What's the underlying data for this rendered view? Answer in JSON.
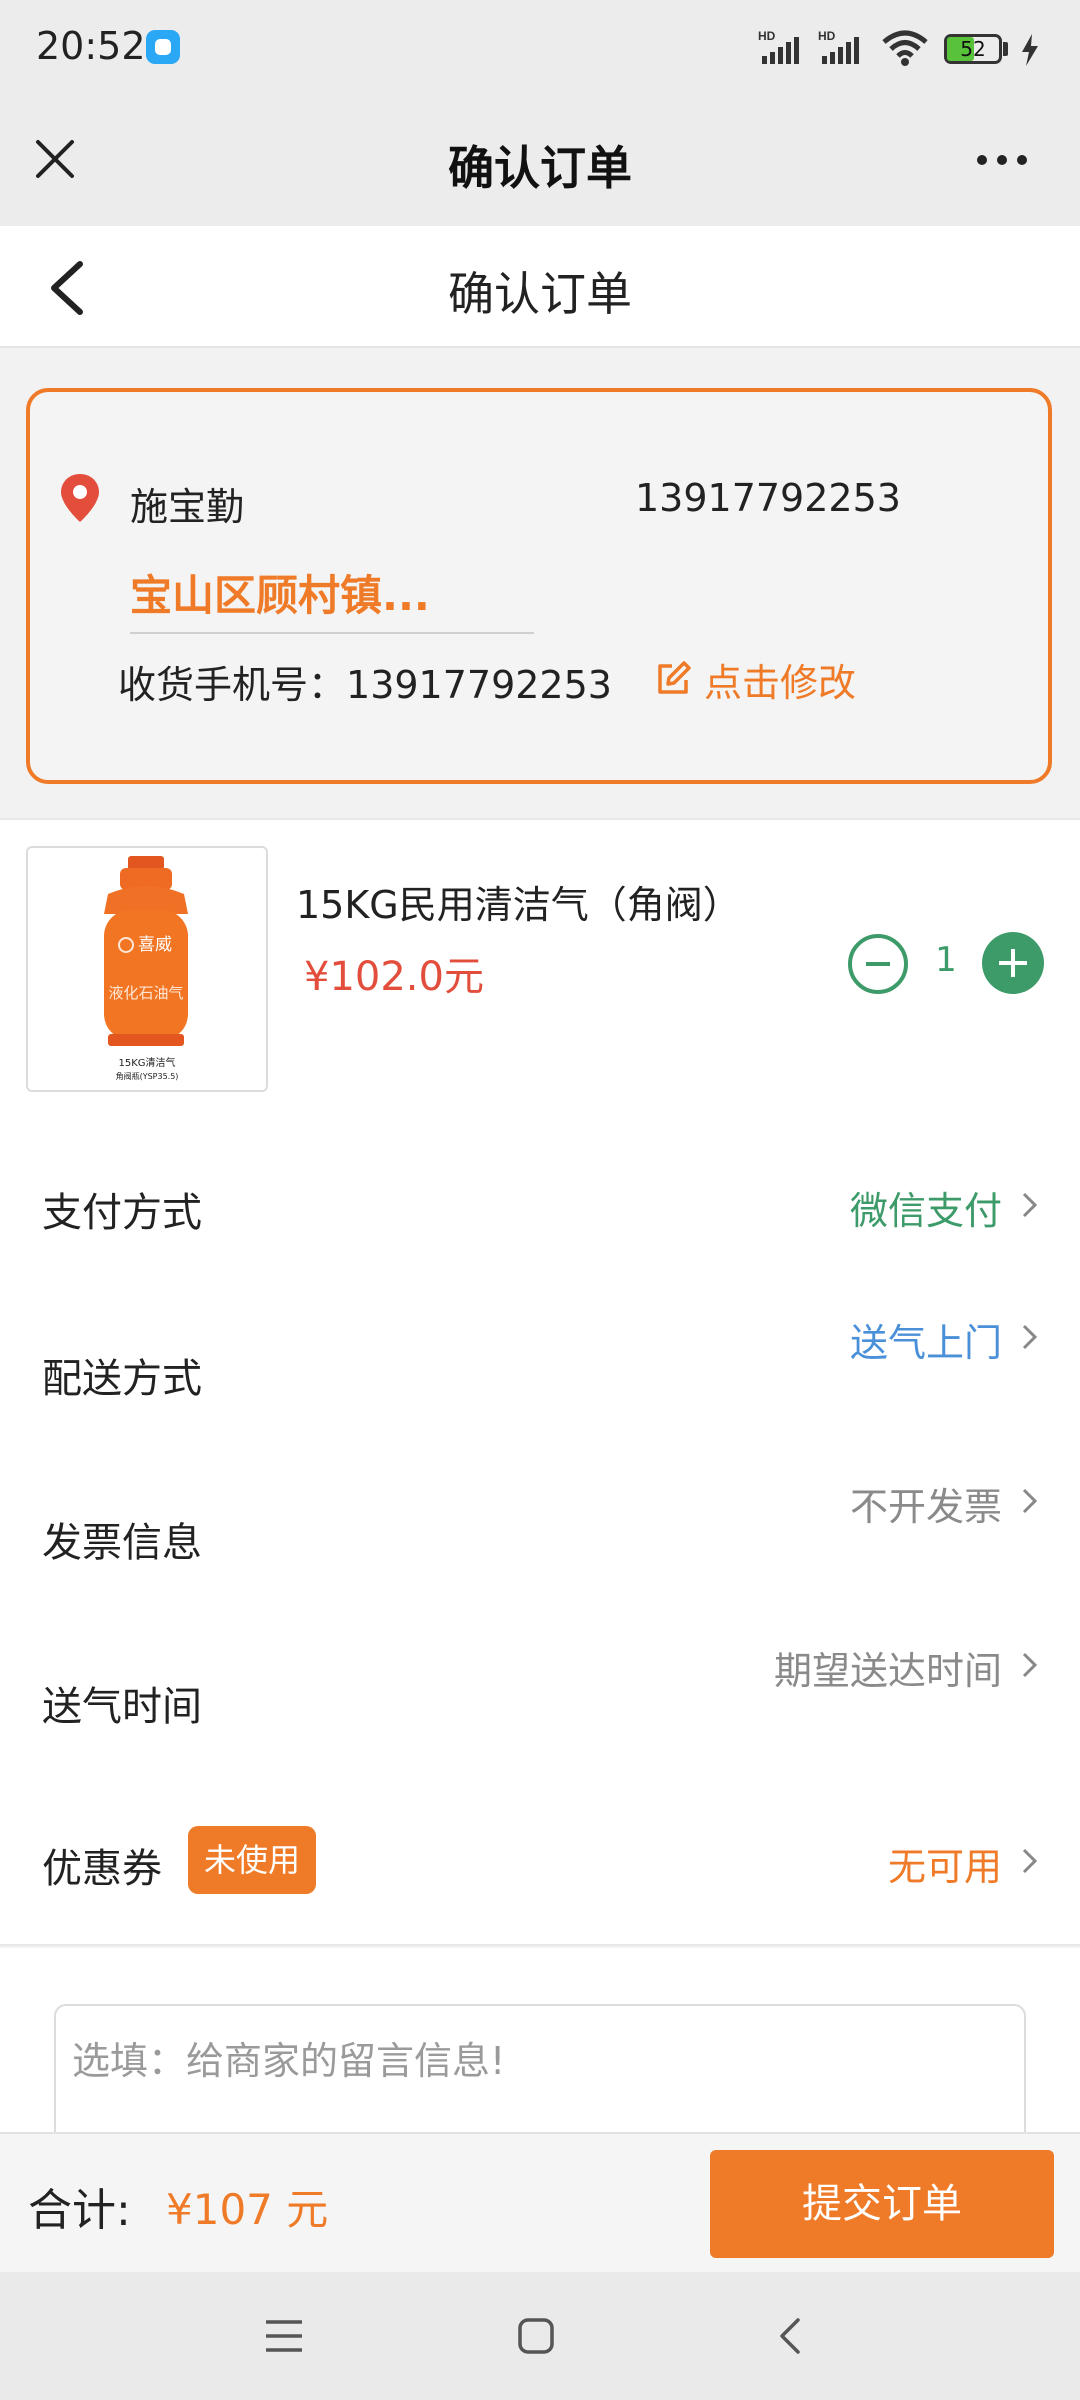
{
  "status_bar": {
    "time": "20:52",
    "signal1": "HD",
    "signal2": "HD",
    "battery": "52",
    "battery_level_pct": 52
  },
  "topbar": {
    "title": "确认订单",
    "close_icon": "close-icon",
    "more_icon": "more-icon"
  },
  "header": {
    "title": "确认订单",
    "back_icon": "back-icon"
  },
  "address": {
    "name": "施宝勤",
    "phone": "13917792253",
    "address": "宝山区顾村镇...",
    "receiver_phone_label": "收货手机号：",
    "receiver_phone": "13917792253",
    "edit_label": "点击修改",
    "pin_icon": "location-pin-icon"
  },
  "product": {
    "name": "15KG民用清洁气（角阀）",
    "price": "¥102.0元",
    "quantity": "1",
    "image": {
      "brand": "喜威",
      "body_text": "液化石油气",
      "caption_line1": "15KG清洁气",
      "caption_line2": "角阀瓶(YSP35.5)"
    }
  },
  "options": [
    {
      "label": "支付方式",
      "value": "微信支付",
      "value_color": "#3d9b6a"
    },
    {
      "label": "配送方式",
      "value": "送气上门",
      "value_color": "#4a90d9"
    },
    {
      "label": "发票信息",
      "value": "不开发票",
      "value_color": "#8a8a8a"
    },
    {
      "label": "送气时间",
      "value": "期望送达时间",
      "value_color": "#8a8a8a"
    },
    {
      "label": "优惠券",
      "badge": "未使用",
      "value": "无可用",
      "value_color": "#ef7a27"
    }
  ],
  "message": {
    "placeholder": "选填：给商家的留言信息!"
  },
  "footer": {
    "total_label": "合计:",
    "total_value": "¥107 元",
    "submit_label": "提交订单"
  },
  "colors": {
    "accent": "#ef7a27",
    "green": "#3d9b6a",
    "price_red": "#e34d3b"
  }
}
